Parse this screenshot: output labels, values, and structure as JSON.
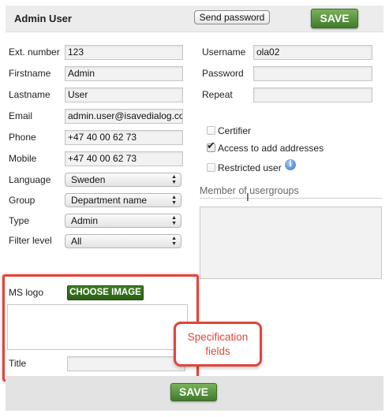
{
  "header": {
    "title": "Admin User",
    "send_password_label": "Send password",
    "save_label": "SAVE"
  },
  "left_fields": [
    {
      "label": "Ext. number",
      "value": "123"
    },
    {
      "label": "Firstname",
      "value": "Admin"
    },
    {
      "label": "Lastname",
      "value": "User"
    },
    {
      "label": "Email",
      "value": "admin.user@isavedialog.com"
    },
    {
      "label": "Phone",
      "value": "+47 40 00 62 73"
    },
    {
      "label": "Mobile",
      "value": "+47 40 00 62 73"
    }
  ],
  "selects": [
    {
      "label": "Language",
      "value": "Sweden"
    },
    {
      "label": "Group",
      "value": "Department name"
    },
    {
      "label": "Type",
      "value": "Admin"
    },
    {
      "label": "Filter level",
      "value": "All"
    }
  ],
  "right_fields": [
    {
      "label": "Username",
      "value": "ola02"
    },
    {
      "label": "Password",
      "value": ""
    },
    {
      "label": "Repeat",
      "value": ""
    }
  ],
  "checkboxes": [
    {
      "label": "Certifier",
      "checked": false
    },
    {
      "label": "Access to add addresses",
      "checked": true
    },
    {
      "label": "Restricted user",
      "checked": false
    }
  ],
  "usergroups": {
    "title": "Member of usergroups"
  },
  "spec": {
    "logo_label": "MS logo",
    "choose_image_label": "CHOOSE IMAGE",
    "title_label": "Title",
    "title_value": ""
  },
  "callout": {
    "line1": "Specification",
    "line2": "fields"
  },
  "footer": {
    "save_label": "SAVE"
  },
  "icons": {
    "info": "info-icon",
    "check": "checkmark-icon",
    "select_arrows": "select-arrows-icon",
    "cursor": "text-cursor-icon"
  },
  "colors": {
    "save_green": "#4f8f36",
    "choose_green": "#356d1c",
    "highlight_red": "#e0453a",
    "header_bg": "#ececec"
  }
}
